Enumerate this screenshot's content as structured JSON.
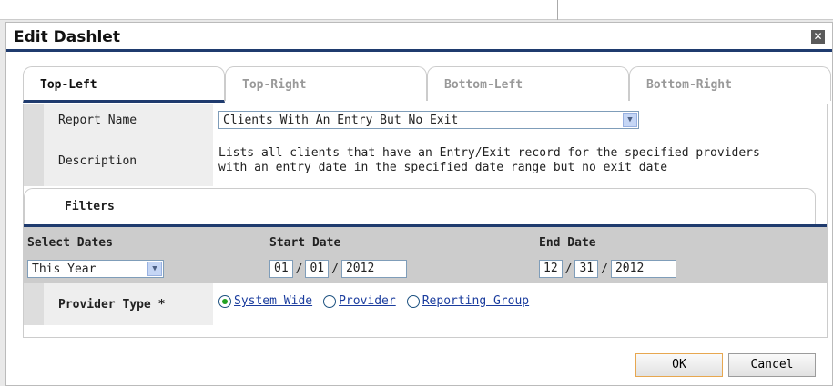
{
  "dialog": {
    "title": "Edit Dashlet",
    "close_icon_glyph": "✕"
  },
  "tabs": [
    {
      "label": "Top-Left",
      "active": true
    },
    {
      "label": "Top-Right",
      "active": false
    },
    {
      "label": "Bottom-Left",
      "active": false
    },
    {
      "label": "Bottom-Right",
      "active": false
    }
  ],
  "report": {
    "name_label": "Report Name",
    "name_value": "Clients With An Entry But No Exit",
    "description_label": "Description",
    "description_line1": "Lists all clients that have an Entry/Exit record for the specified providers",
    "description_line2": "with an entry date in the specified date range but no exit date"
  },
  "filters": {
    "tab_label": "Filters",
    "select_dates_label": "Select Dates",
    "select_dates_value": "This Year",
    "start_date_label": "Start Date",
    "start_month": "01",
    "start_day": "01",
    "start_year": "2012",
    "end_date_label": "End Date",
    "end_month": "12",
    "end_day": "31",
    "end_year": "2012",
    "date_separator": "/",
    "provider_type_label": "Provider Type *",
    "provider_options": [
      {
        "label": "System Wide",
        "checked": true
      },
      {
        "label": "Provider",
        "checked": false
      },
      {
        "label": "Reporting Group",
        "checked": false
      }
    ]
  },
  "buttons": {
    "ok_label": "OK",
    "cancel_label": "Cancel"
  },
  "colors": {
    "accent_bar": "#1f3b6e",
    "link": "#1a3c9e",
    "radio_checked": "#21a121"
  }
}
